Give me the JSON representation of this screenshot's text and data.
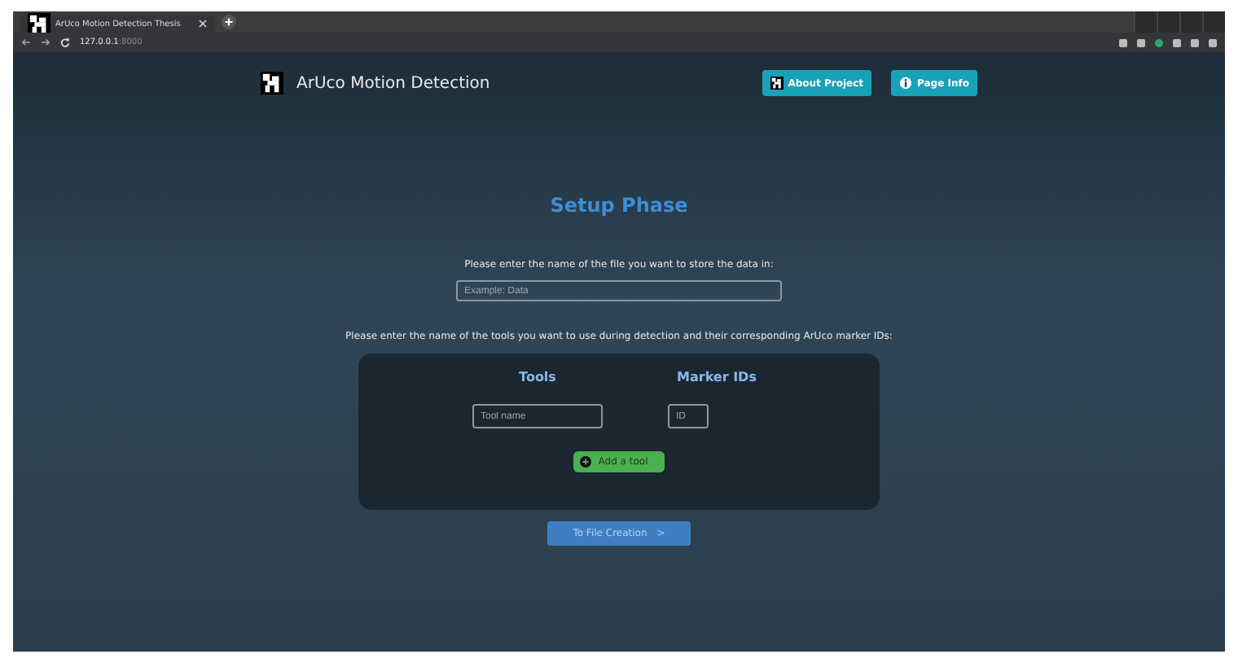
{
  "browser": {
    "tab_title": "ArUco Motion Detection Thesis",
    "address_host": "127.0.0.1",
    "address_port": ":8000"
  },
  "navbar": {
    "brand": "ArUco Motion Detection",
    "buttons": [
      {
        "label": "About Project",
        "kind": "marker"
      },
      {
        "label": "Page Info",
        "kind": "info"
      }
    ]
  },
  "title": "Setup Phase",
  "file_prompt": "Please enter the name of the file you want to store the data in:",
  "file_field": {
    "placeholder": "Example: Data"
  },
  "tools_prompt": "Please enter the name of the tools you want to use during detection and their corresponding ArUco marker IDs:",
  "tools_table": {
    "columns": [
      "Tools",
      "Marker IDs"
    ],
    "rows": [
      {
        "tool_placeholder": "Tool name",
        "id_placeholder": "ID"
      }
    ]
  },
  "add_button": "Add a tool",
  "next_button": "To File Creation",
  "next_arrow": ">"
}
